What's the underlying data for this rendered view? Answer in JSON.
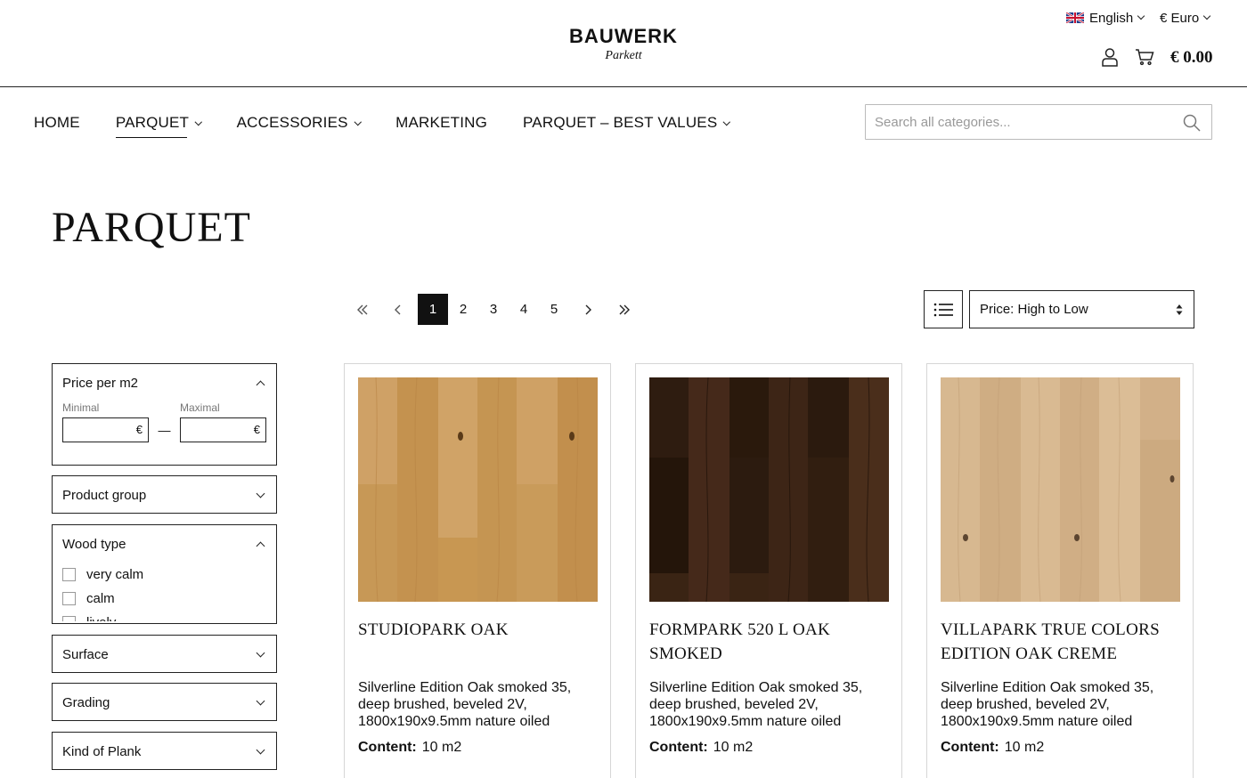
{
  "header": {
    "logo_main": "BAUWERK",
    "logo_sub": "Parkett",
    "language": "English",
    "currency": "€ Euro",
    "cart_total": "€ 0.00"
  },
  "nav": {
    "items": [
      {
        "label": "HOME",
        "dropdown": false
      },
      {
        "label": "PARQUET",
        "dropdown": true,
        "active": true
      },
      {
        "label": "ACCESSORIES",
        "dropdown": true
      },
      {
        "label": "MARKETING",
        "dropdown": false
      },
      {
        "label": "PARQUET – BEST VALUES",
        "dropdown": true
      }
    ],
    "search_placeholder": "Search all categories..."
  },
  "page_title": "PARQUET",
  "pagination": {
    "pages": [
      "1",
      "2",
      "3",
      "4",
      "5"
    ],
    "current": "1"
  },
  "sort": {
    "selected": "Price: High to Low"
  },
  "filters": {
    "price": {
      "title": "Price per m2",
      "min_label": "Minimal",
      "max_label": "Maximal",
      "currency_symbol": "€",
      "separator": "—"
    },
    "product_group": "Product group",
    "wood_type": {
      "title": "Wood type",
      "options": [
        "very calm",
        "calm",
        "lively"
      ]
    },
    "surface": "Surface",
    "grading": "Grading",
    "kind_of_plank": "Kind of Plank"
  },
  "products": [
    {
      "name": "STUDIOPARK OAK",
      "description": "Silverline Edition Oak smoked 35, deep brushed, beveled 2V, 1800x190x9.5mm nature oiled",
      "content_label": "Content:",
      "content_value": "10 m2",
      "wood_color": "#c99a5b"
    },
    {
      "name": "FORMPARK 520 L OAK SMOKED",
      "description": "Silverline Edition Oak smoked 35, deep brushed, beveled 2V, 1800x190x9.5mm nature oiled",
      "content_label": "Content:",
      "content_value": "10 m2",
      "wood_color": "#3a2414"
    },
    {
      "name": "VILLAPARK TRUE COLORS EDITION OAK CREME",
      "description": "Silverline Edition Oak smoked 35, deep brushed, beveled 2V, 1800x190x9.5mm nature oiled",
      "content_label": "Content:",
      "content_value": "10 m2",
      "wood_color": "#d4b48c"
    }
  ]
}
